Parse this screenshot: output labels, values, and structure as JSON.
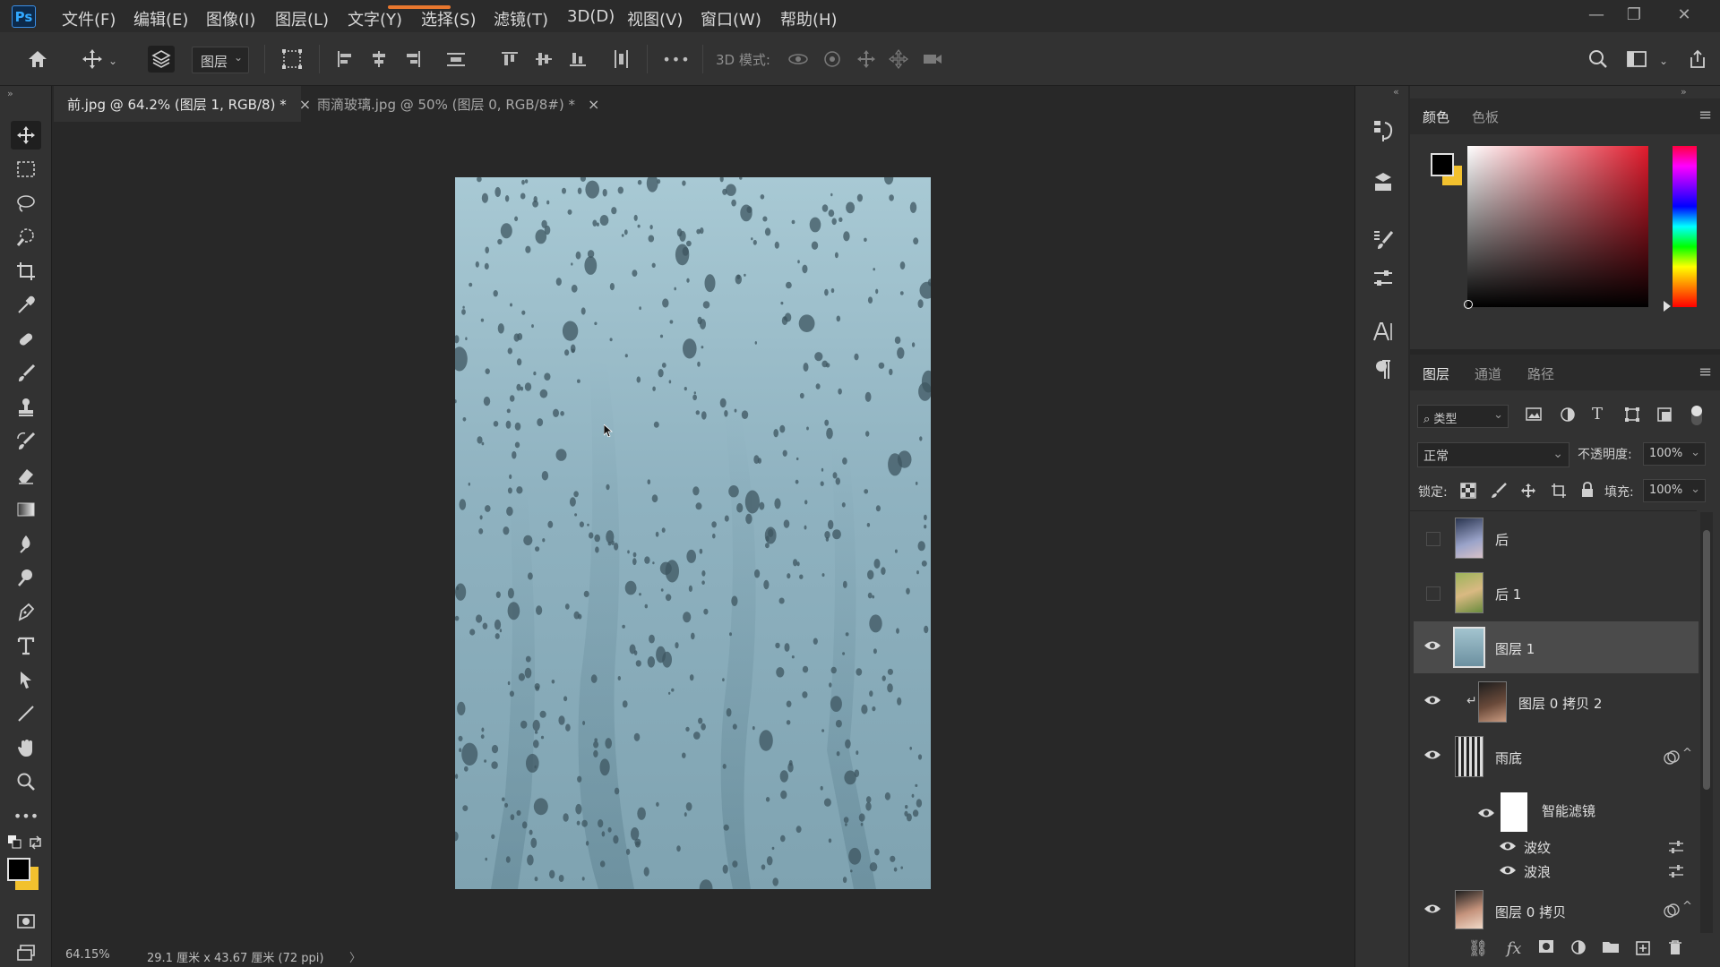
{
  "app": {
    "logo": "Ps"
  },
  "menu": [
    {
      "label": "文件(F)"
    },
    {
      "label": "编辑(E)"
    },
    {
      "label": "图像(I)"
    },
    {
      "label": "图层(L)"
    },
    {
      "label": "文字(Y)"
    },
    {
      "label": "选择(S)"
    },
    {
      "label": "滤镜(T)"
    },
    {
      "label": "3D(D)"
    },
    {
      "label": "视图(V)"
    },
    {
      "label": "窗口(W)"
    },
    {
      "label": "帮助(H)"
    }
  ],
  "window_controls": {
    "minimize": "—",
    "restore": "❐",
    "close": "✕"
  },
  "options_bar": {
    "layer_select_value": "图层",
    "more_label": "•••",
    "mode_3d_label": "3D 模式:"
  },
  "tabs": [
    {
      "label": "前.jpg @ 64.2% (图层 1, RGB/8) *",
      "active": true,
      "close": "×"
    },
    {
      "label": "雨滴玻璃.jpg @ 50% (图层 0, RGB/8#) *",
      "active": false,
      "close": "×"
    }
  ],
  "status": {
    "zoom": "64.15%",
    "doc_size": "29.1 厘米 x 43.67 厘米 (72 ppi)",
    "arrow": "〉"
  },
  "color_panel": {
    "tabs": [
      "颜色",
      "色板"
    ],
    "foreground": "#000000",
    "background": "#f2c12e"
  },
  "layers_panel": {
    "tabs": [
      "图层",
      "通道",
      "路径"
    ],
    "filter_kind": "类型",
    "blend_mode": "正常",
    "opacity_label": "不透明度:",
    "opacity_value": "100%",
    "lock_label": "锁定:",
    "fill_label": "填充:",
    "fill_value": "100%",
    "layers": [
      {
        "name": "后",
        "visible": false
      },
      {
        "name": "后 1",
        "visible": false
      },
      {
        "name": "图层 1",
        "visible": true,
        "selected": true
      },
      {
        "name": "图层 0 拷贝 2",
        "visible": true,
        "clipped": true
      },
      {
        "name": "雨底",
        "visible": true,
        "smart": true
      },
      {
        "name": "智能滤镜",
        "visible": true,
        "filter_group": true
      },
      {
        "name": "波纹",
        "visible": true,
        "filter": true
      },
      {
        "name": "波浪",
        "visible": true,
        "filter": true
      },
      {
        "name": "图层 0 拷贝",
        "visible": true,
        "smart": true
      }
    ]
  },
  "accent": "#31a8ff"
}
